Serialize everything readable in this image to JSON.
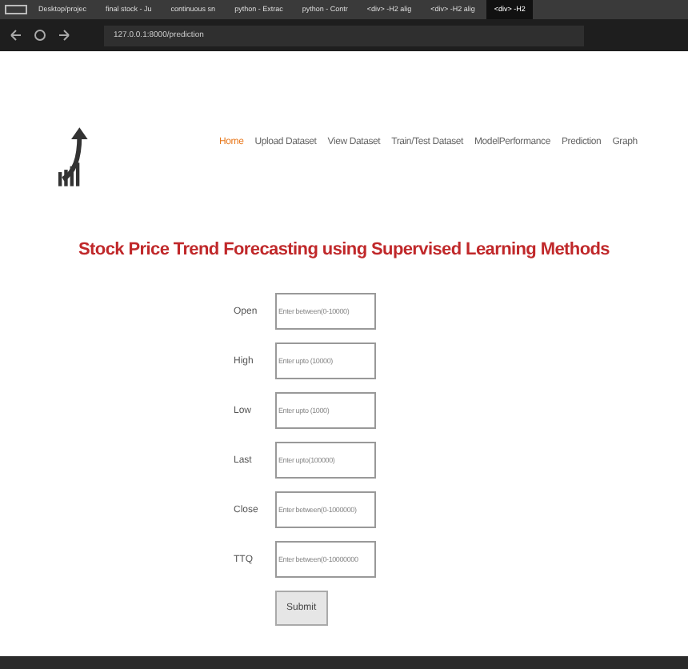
{
  "browser": {
    "tabs": [
      {
        "label": "Desktop/projec",
        "selected": false
      },
      {
        "label": "final stock - Ju",
        "selected": false
      },
      {
        "label": "continuous sn",
        "selected": false
      },
      {
        "label": "python - Extrac",
        "selected": false
      },
      {
        "label": "python - Contr",
        "selected": false
      },
      {
        "label": "<div> -H2 alig",
        "selected": false
      },
      {
        "label": "<div> -H2 alig",
        "selected": false
      },
      {
        "label": "<div> -H2",
        "selected": true
      }
    ],
    "address": "127.0.0.1:8000/prediction"
  },
  "nav": [
    {
      "label": "Home",
      "selected": true
    },
    {
      "label": "Upload Dataset",
      "selected": false
    },
    {
      "label": "View Dataset",
      "selected": false
    },
    {
      "label": "Train/Test Dataset",
      "selected": false
    },
    {
      "label": "ModelPerformance",
      "selected": false
    },
    {
      "label": "Prediction",
      "selected": false
    },
    {
      "label": "Graph",
      "selected": false
    }
  ],
  "title": "Stock Price Trend Forecasting using Supervised Learning Methods",
  "fields": [
    {
      "label": "Open",
      "placeholder": "Enter between(0-10000)"
    },
    {
      "label": "High",
      "placeholder": "Enter upto (10000)"
    },
    {
      "label": "Low",
      "placeholder": "Enter upto (1000)"
    },
    {
      "label": "Last",
      "placeholder": "Enter upto(100000)"
    },
    {
      "label": "Close",
      "placeholder": "Enter between(0-1000000)"
    },
    {
      "label": "TTQ",
      "placeholder": "Enter between(0-10000000"
    }
  ],
  "submit": "Submit"
}
